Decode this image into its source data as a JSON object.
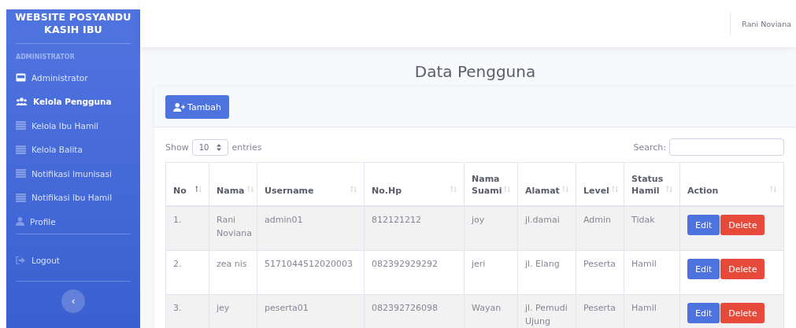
{
  "brand": "WEBSITE POSYANDU KASIH IBU",
  "sidebar": {
    "heading": "ADMINISTRATOR",
    "items": [
      {
        "label": "Administrator",
        "kind": "card",
        "selected": false
      },
      {
        "label": "Kelola Pengguna",
        "kind": "users",
        "selected": true
      },
      {
        "label": "Kelola Ibu Hamil",
        "kind": "table",
        "selected": false
      },
      {
        "label": "Kelola Balita",
        "kind": "table",
        "selected": false
      },
      {
        "label": "Notifikasi Imunisasi",
        "kind": "table",
        "selected": false
      },
      {
        "label": "Notifikasi Ibu Hamil",
        "kind": "table",
        "selected": false
      },
      {
        "label": "Profile",
        "kind": "user",
        "selected": false
      }
    ],
    "logout": "Logout",
    "toggle": "‹"
  },
  "topbar": {
    "user": "Rani Noviana"
  },
  "page_title": "Data Pengguna",
  "add_button": "Tambah",
  "length": {
    "before": "Show",
    "value": "10",
    "after": "entries"
  },
  "search": {
    "label": "Search:"
  },
  "table": {
    "columns": [
      {
        "label": "No",
        "sorted": true
      },
      {
        "label": "Nama",
        "sorted": false
      },
      {
        "label": "Username",
        "sorted": false
      },
      {
        "label": "No.Hp",
        "sorted": false
      },
      {
        "label": "Nama Suami",
        "sorted": false
      },
      {
        "label": "Alamat",
        "sorted": false
      },
      {
        "label": "Level",
        "sorted": false
      },
      {
        "label": "Status Hamil",
        "sorted": false
      },
      {
        "label": "Action",
        "sorted": false
      }
    ],
    "rows": [
      {
        "cells": [
          "1.",
          "Rani Noviana",
          "admin01",
          "812121212",
          "joy",
          "jl.damai",
          "Admin",
          "Tidak"
        ],
        "actions": [
          "Edit",
          "Delete"
        ]
      },
      {
        "cells": [
          "2.",
          "zea nis",
          "5171044512020003",
          "082392929292",
          "jeri",
          "jl. Elang",
          "Peserta",
          "Hamil"
        ],
        "actions": [
          "Edit",
          "Delete"
        ]
      },
      {
        "cells": [
          "3.",
          "jey",
          "peserta01",
          "082392726098",
          "Wayan",
          "jl. Pemudi Ujung",
          "Peserta",
          "Hamil"
        ],
        "actions": [
          "Edit",
          "Delete"
        ]
      }
    ]
  }
}
